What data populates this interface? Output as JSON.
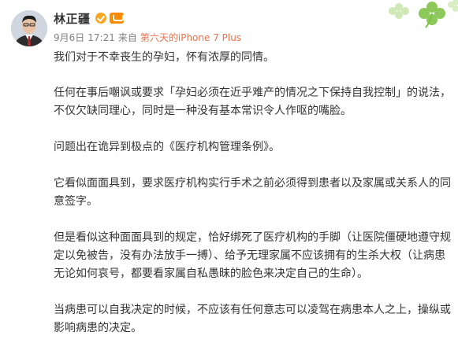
{
  "author": {
    "name": "林正疆",
    "verified_icon": "verified-badge-icon",
    "member_icon": "vip-member-icon"
  },
  "meta": {
    "date": "9月6日",
    "time": "17:21",
    "from_label": "来自",
    "source": "第六天的iPhone 7 Plus"
  },
  "decoration": {
    "icon": "clover-icon",
    "color": "#7bc143"
  },
  "paragraphs": [
    "我们对于不幸丧生的孕妇，怀有浓厚的同情。",
    "任何在事后嘲讽或要求「孕妇必须在近乎难产的情况之下保持自我控制」的说法，不仅欠缺同理心，同时是一种没有基本常识令人作呕的嘴脸。",
    "问题出在诡异到极点的《医疗机构管理条例》。",
    "它看似面面具到，要求医疗机构实行手术之前必须得到患者以及家属或关系人的同意签字。",
    "但是看似这种面面具到的规定，恰好绑死了医疗机构的手脚（让医院僵硬地遵守规定以免被告，没有办法放手一搏）、给予无理家属不应该拥有的生杀大权（让病患无论如何哀号，都要看家属自私愚昧的脸色来决定自己的生命）。",
    "当病患可以自我决定的时候，不应该有任何意志可以凌驾在病患本人之上，操纵或影响病患的决定。"
  ]
}
